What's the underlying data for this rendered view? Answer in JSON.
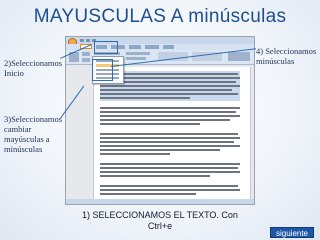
{
  "slide": {
    "title": "MAYUSCULAS A minúsculas",
    "notes": {
      "step4": "4) Seleccionamos minúsculas",
      "step2": "2)Seleccionamos Inicio",
      "step3": "3)Seleccionamos cambiar mayúsculas a minúsculas"
    },
    "caption": "1) SELECCIONAMOS  EL TEXTO. Con Ctrl+e",
    "next_button": "siguiente"
  },
  "colors": {
    "title": "#1d4f8f",
    "next_button": "#1e56a8",
    "selection_highlight": "#a9c4e6"
  },
  "icons": [
    "office-button-icon",
    "dropdown-menu-icon"
  ]
}
